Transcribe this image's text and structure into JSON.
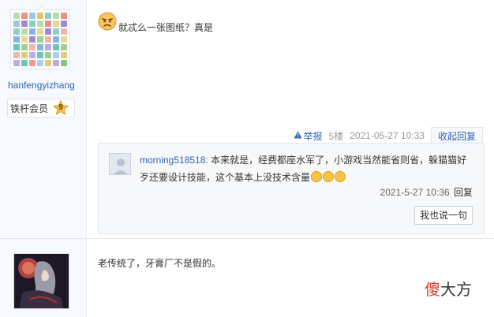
{
  "post1": {
    "username": "hanfengyizhang",
    "member_label": "铁杆会员",
    "member_level": "9",
    "text": "就忒么一张图纸？真是",
    "report_label": "举报",
    "floor": "5楼",
    "datetime": "2021-05-27 10:33",
    "collapse_reply_label": "收起回复"
  },
  "reply": {
    "username": "morning518518:",
    "text": "本来就是，经费都座水军了，小游戏当然能省则省，躲猫猫好歹还要设计技能，这个基本上没技术含量",
    "datetime": "2021-5-27 10:36",
    "reply_link": "回复",
    "say_button": "我也说一句"
  },
  "post2": {
    "text": "老传统了，牙膏厂不是假的。"
  },
  "watermark": {
    "highlight": "傻",
    "rest": "大方"
  },
  "icons": {
    "emoji": "annoyed-face-emoji-icon",
    "report": "warning-triangle-icon",
    "member_star": "star-level-badge-icon",
    "mini_emoji": "laughing-face-emoji-icon"
  },
  "colors": {
    "link": "#2d64b3",
    "sidebar_bg": "#f6f9fd",
    "reply_bg": "#f7f8fa",
    "watermark_red": "#e23b2a"
  }
}
